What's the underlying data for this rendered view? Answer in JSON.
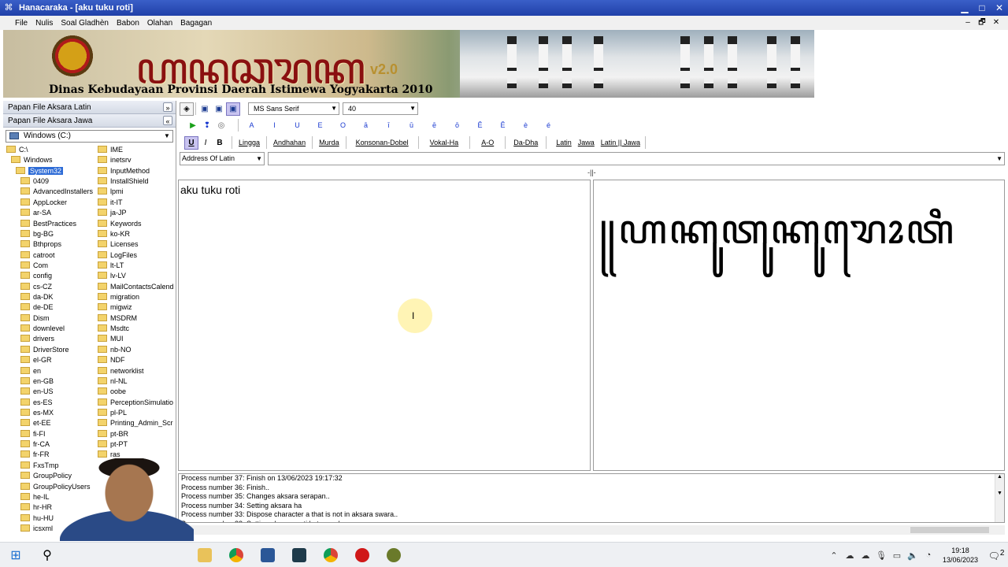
{
  "window": {
    "title": "Hanacaraka - [aku tuku roti]",
    "min": "▁",
    "max": "□",
    "close": "✕"
  },
  "menu": {
    "items": [
      "File",
      "Nulis",
      "Soal Gladhèn",
      "Babon",
      "Olahan",
      "Bagagan"
    ],
    "mdi": [
      "–",
      "🗗",
      "✕"
    ]
  },
  "banner": {
    "script_title": "ꦲꦤꦕꦫꦏ",
    "version": "v2.0",
    "subtitle": "Dinas Kebudayaan Provinsi Daerah Istimewa Yogyakarta 2010"
  },
  "sidebar": {
    "latin_panel": "Papan File Aksara Latin",
    "jawa_panel": "Papan File Aksara Jawa",
    "drive": "Windows (C:)",
    "tree_col1": [
      "C:\\",
      "Windows",
      "System32",
      "0409",
      "AdvancedInstallers",
      "AppLocker",
      "ar-SA",
      "BestPractices",
      "bg-BG",
      "Bthprops",
      "catroot",
      "Com",
      "config",
      "cs-CZ",
      "da-DK",
      "de-DE",
      "Dism",
      "downlevel",
      "drivers",
      "DriverStore",
      "el-GR",
      "en",
      "en-GB",
      "en-US",
      "es-ES",
      "es-MX",
      "et-EE",
      "fi-FI",
      "fr-CA",
      "fr-FR",
      "FxsTmp",
      "GroupPolicy",
      "GroupPolicyUsers",
      "he-IL",
      "hr-HR",
      "hu-HU",
      "icsxml"
    ],
    "tree_col2": [
      "IME",
      "inetsrv",
      "InputMethod",
      "InstallShield",
      "lpmi",
      "it-IT",
      "ja-JP",
      "Keywords",
      "ko-KR",
      "Licenses",
      "LogFiles",
      "lt-LT",
      "lv-LV",
      "MailContactsCalend",
      "migration",
      "migwiz",
      "MSDRM",
      "Msdtc",
      "MUI",
      "nb-NO",
      "NDF",
      "networklist",
      "nl-NL",
      "oobe",
      "PerceptionSimulatio",
      "pl-PL",
      "Printing_Admin_Scr",
      "pt-BR",
      "pt-PT",
      "ras"
    ]
  },
  "toolbar": {
    "font_name": "MS Sans Serif",
    "font_size": "40",
    "vowels": [
      "A",
      "I",
      "U",
      "E",
      "O",
      "ā",
      "ī",
      "ū",
      "ē",
      "ō",
      "Ê",
      "Ě",
      "è",
      "é"
    ],
    "underline": "U",
    "italic": "I",
    "bold": "B",
    "buttons": [
      "Lingga",
      "Andhahan",
      "Murda",
      "Konsonan-Dobel",
      "Vokal-Ha",
      "A-O",
      "Da-Dha",
      "Latin",
      "Jawa",
      "Latin || Jawa"
    ]
  },
  "address": {
    "label": "Address Of Latin",
    "value": ""
  },
  "splitter": "-||-",
  "latin_text": "aku tuku roti",
  "jawa_text": "꧋ꦲꦏꦸꦠꦸꦏꦸꦫꦺꦴꦠꦶ",
  "log": [
    "Process number 37: Finish on 13/06/2023 19:17:32",
    "Process number 36: Finish..",
    "Process number 35: Changes aksara serapan..",
    "Process number 34: Setting aksara ha",
    "Process number 33: Dispose character a that is not in aksara swara..",
    "Process number 32: Setting aksara mati ketemu aksara swara.."
  ],
  "taskbar": {
    "time": "19:18",
    "date": "13/06/2023",
    "notifications": "2"
  }
}
